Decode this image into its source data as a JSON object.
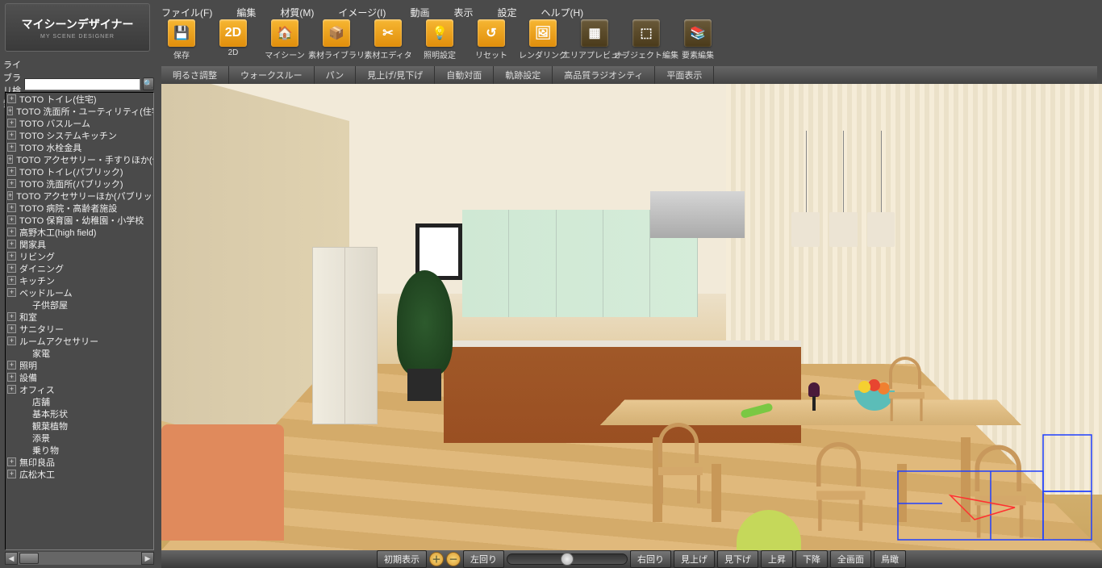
{
  "app": {
    "title": "マイシーンデザイナー",
    "subtitle": "MY SCENE DESIGNER"
  },
  "menu": {
    "file": "ファイル(F)",
    "edit": "編集",
    "material": "材質(M)",
    "image": "イメージ(I)",
    "movie": "動画",
    "view": "表示",
    "settings": "設定",
    "help": "ヘルプ(H)"
  },
  "toolbar": [
    {
      "label": "保存",
      "glyph": "💾"
    },
    {
      "label": "2D",
      "glyph": "2D"
    },
    {
      "label": "マイシーン",
      "glyph": "🏠"
    },
    {
      "label": "素材ライブラリ",
      "glyph": "📦"
    },
    {
      "label": "素材エディタ",
      "glyph": "✂"
    },
    {
      "label": "照明設定",
      "glyph": "💡"
    },
    {
      "label": "リセット",
      "glyph": "↺"
    },
    {
      "label": "レンダリング",
      "glyph": "🖼"
    },
    {
      "label": "エリアプレビュー",
      "glyph": "▦"
    },
    {
      "label": "オブジェクト編集",
      "glyph": "⬚"
    },
    {
      "label": "要素編集",
      "glyph": "📚"
    }
  ],
  "subtoolbar": [
    "明るさ調整",
    "ウォークスルー",
    "パン",
    "見上げ/見下げ",
    "自動対面",
    "軌跡設定",
    "高品質ラジオシティ",
    "平面表示"
  ],
  "search": {
    "label": "ライブラリ検索:",
    "value": ""
  },
  "tree": [
    {
      "t": "TOTO トイレ(住宅)",
      "e": 1
    },
    {
      "t": "TOTO 洗面所・ユーティリティ(住宅)",
      "e": 1
    },
    {
      "t": "TOTO バスルーム",
      "e": 1
    },
    {
      "t": "TOTO システムキッチン",
      "e": 1
    },
    {
      "t": "TOTO 水栓金具",
      "e": 1
    },
    {
      "t": "TOTO アクセサリー・手すりほか(住宅)",
      "e": 1
    },
    {
      "t": "TOTO トイレ(パブリック)",
      "e": 1
    },
    {
      "t": "TOTO 洗面所(パブリック)",
      "e": 1
    },
    {
      "t": "TOTO アクセサリーほか(パブリック)",
      "e": 1
    },
    {
      "t": "TOTO 病院・高齢者施設",
      "e": 1
    },
    {
      "t": "TOTO 保育園・幼稚園・小学校",
      "e": 1
    },
    {
      "t": "高野木工(high field)",
      "e": 1
    },
    {
      "t": "関家具",
      "e": 1
    },
    {
      "t": "リビング",
      "e": 1
    },
    {
      "t": "ダイニング",
      "e": 1
    },
    {
      "t": "キッチン",
      "e": 1
    },
    {
      "t": "ベッドルーム",
      "e": 1
    },
    {
      "t": "子供部屋",
      "e": 0
    },
    {
      "t": "和室",
      "e": 1
    },
    {
      "t": "サニタリー",
      "e": 1
    },
    {
      "t": "ルームアクセサリー",
      "e": 1
    },
    {
      "t": "家電",
      "e": 0
    },
    {
      "t": "照明",
      "e": 1
    },
    {
      "t": "設備",
      "e": 1
    },
    {
      "t": "オフィス",
      "e": 1
    },
    {
      "t": "店舗",
      "e": 0
    },
    {
      "t": "基本形状",
      "e": 0
    },
    {
      "t": "観葉植物",
      "e": 0
    },
    {
      "t": "添景",
      "e": 0
    },
    {
      "t": "乗り物",
      "e": 0
    },
    {
      "t": "無印良品",
      "e": 1
    },
    {
      "t": "広松木工",
      "e": 1
    }
  ],
  "bottombar": {
    "initial": "初期表示",
    "left_rot": "左回り",
    "right_rot": "右回り",
    "look_up": "見上げ",
    "look_down": "見下げ",
    "rise": "上昇",
    "lower": "下降",
    "fullscreen": "全画面",
    "bird": "鳥瞰"
  }
}
